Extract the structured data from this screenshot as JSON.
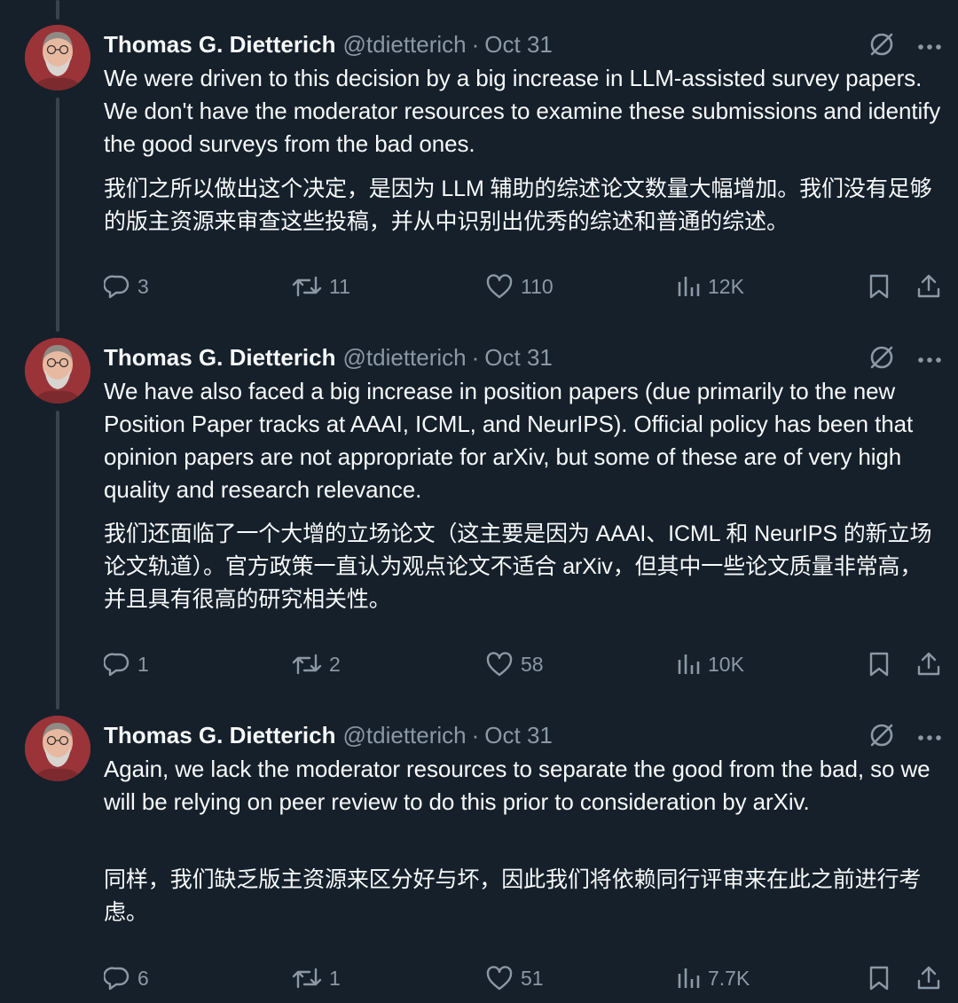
{
  "tweets": [
    {
      "name": "Thomas G. Dietterich",
      "handle": "@tdietterich",
      "separator": "·",
      "date": "Oct 31",
      "text_en": "We were driven to this decision by a big increase in LLM-assisted survey papers. We don't have the moderator resources to examine these submissions and identify the good surveys from the bad ones.",
      "text_zh": "我们之所以做出这个决定，是因为 LLM 辅助的综述论文数量大幅增加。我们没有足够的版主资源来审查这些投稿，并从中识别出优秀的综述和普通的综述。",
      "replies": "3",
      "retweets": "11",
      "likes": "110",
      "views": "12K"
    },
    {
      "name": "Thomas G. Dietterich",
      "handle": "@tdietterich",
      "separator": "·",
      "date": "Oct 31",
      "text_en": "We have also faced a big increase in position papers (due primarily to the new Position Paper tracks at AAAI, ICML, and NeurIPS). Official policy has been that opinion papers are not appropriate for arXiv, but some of these are of very high quality and research relevance.",
      "text_zh": "我们还面临了一个大增的立场论文（这主要是因为 AAAI、ICML 和 NeurIPS 的新立场论文轨道）。官方政策一直认为观点论文不适合 arXiv，但其中一些论文质量非常高，并且具有很高的研究相关性。",
      "replies": "1",
      "retweets": "2",
      "likes": "58",
      "views": "10K"
    },
    {
      "name": "Thomas G. Dietterich",
      "handle": "@tdietterich",
      "separator": "·",
      "date": "Oct 31",
      "text_en": "Again, we lack the moderator resources to separate the good from the bad, so we will be relying on peer review to do this prior to consideration by arXiv.",
      "text_zh": "同样，我们缺乏版主资源来区分好与坏，因此我们将依赖同行评审来在此之前进行考虑。",
      "replies": "6",
      "retweets": "1",
      "likes": "51",
      "views": "7.7K"
    }
  ],
  "colors": {
    "background": "#15202b",
    "text": "#f7f9f9",
    "muted": "#8b98a5",
    "thread_line": "#38444d"
  },
  "icons": [
    "grok-icon",
    "more-icon",
    "reply-icon",
    "retweet-icon",
    "like-icon",
    "views-icon",
    "bookmark-icon",
    "share-icon"
  ]
}
